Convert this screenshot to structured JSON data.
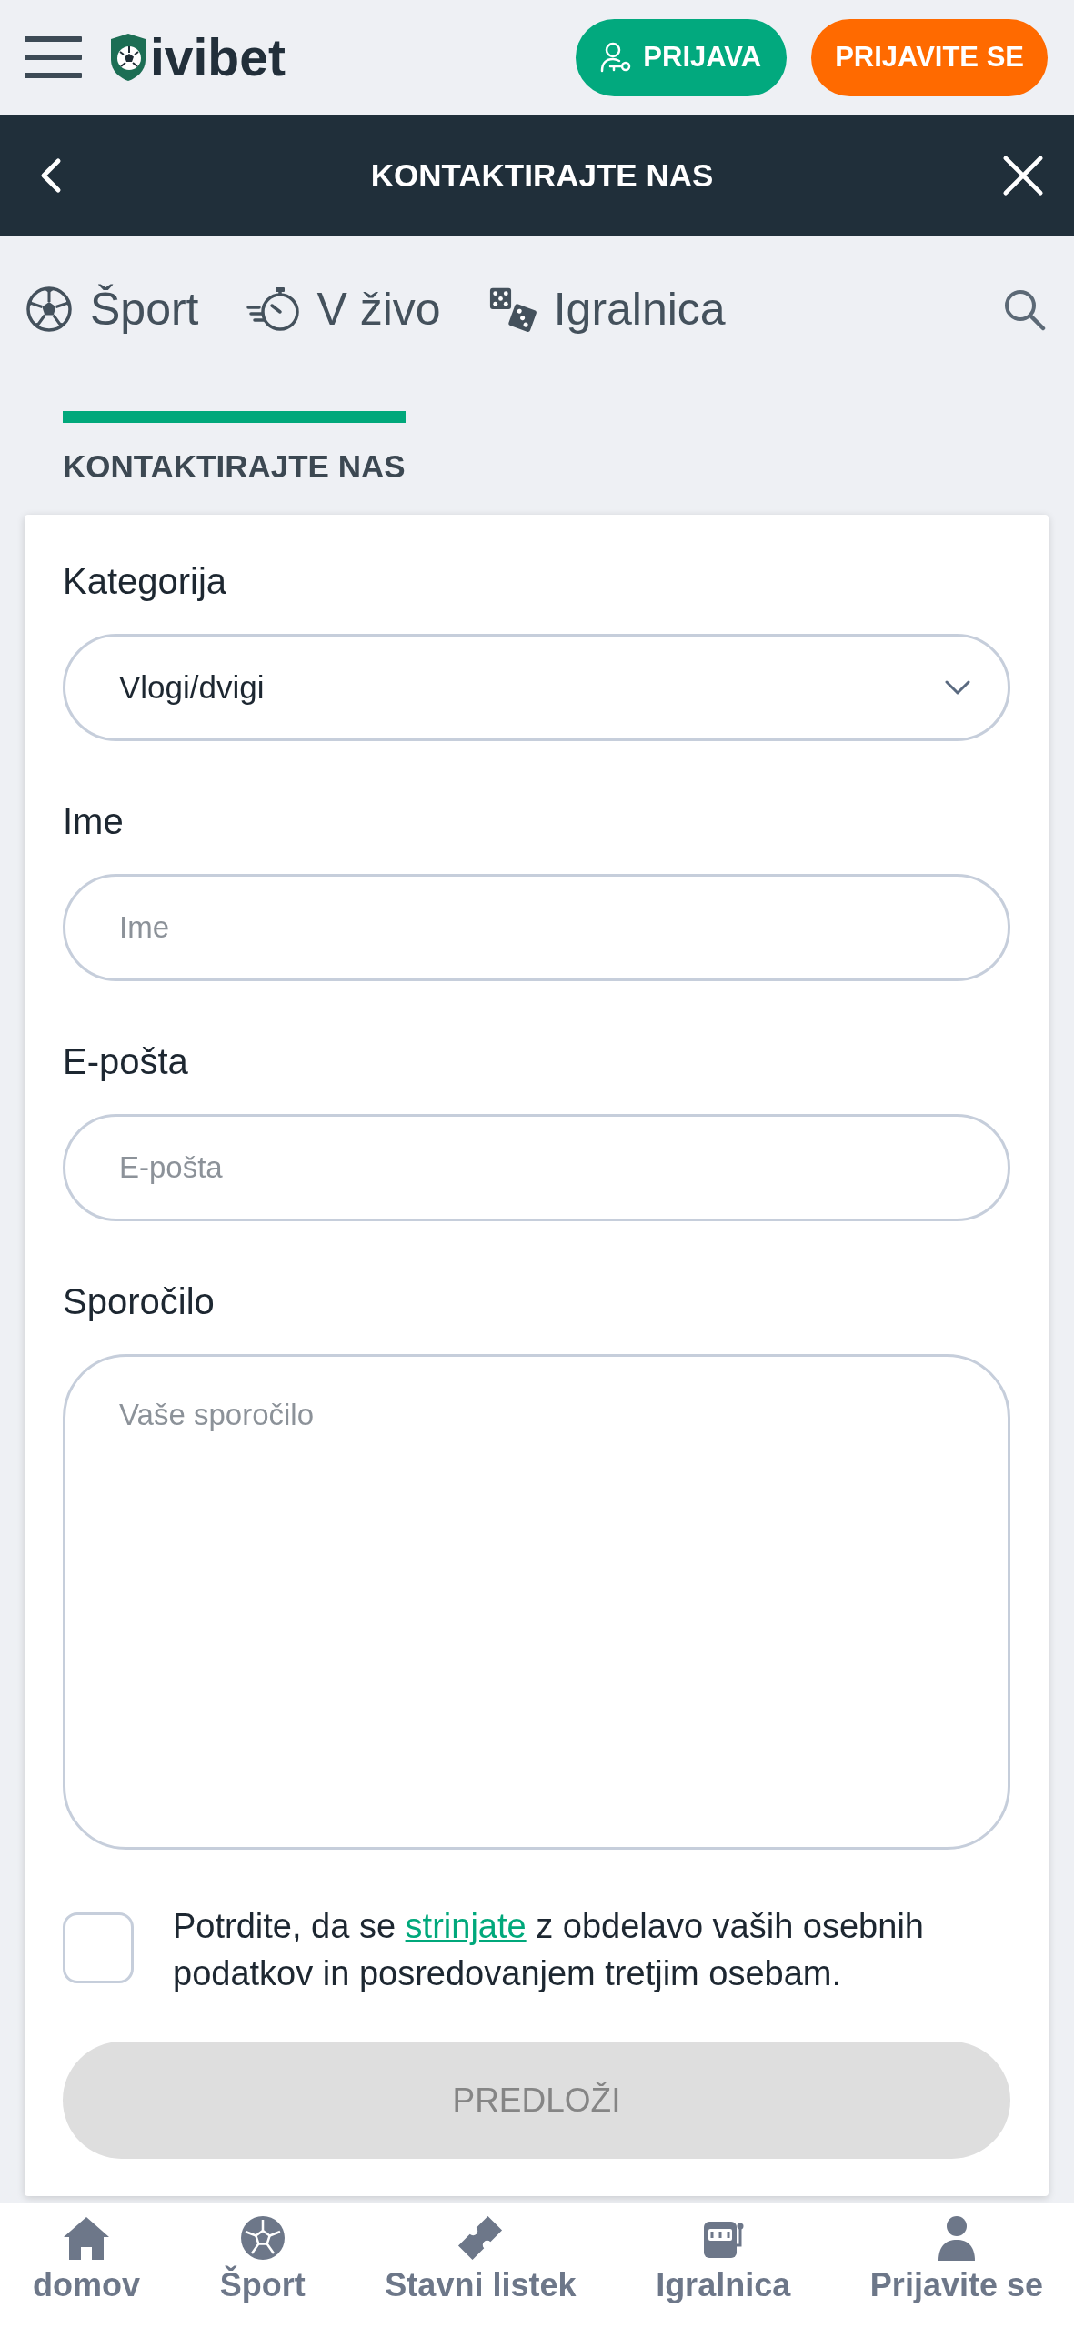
{
  "header": {
    "logo_text": "ivibet",
    "login_button": "PRIJAVA",
    "register_button": "PRIJAVITE SE"
  },
  "title_bar": {
    "title": "KONTAKTIRAJTE NAS"
  },
  "nav": [
    {
      "kind": "ball",
      "label": "Šport",
      "selected": false
    },
    {
      "kind": "live",
      "label": "V živo",
      "selected": false
    },
    {
      "kind": "dice",
      "label": "Igralnica",
      "selected": false
    }
  ],
  "section_tabs": [
    {
      "label": "KONTAKTIRAJTE NAS",
      "selected": true
    }
  ],
  "form": {
    "fields": [
      {
        "kind": "select",
        "label": "Kategorija",
        "value": "Vlogi/dvigi"
      },
      {
        "kind": "input",
        "label": "Ime",
        "placeholder": "Ime"
      },
      {
        "kind": "input",
        "label": "E-pošta",
        "placeholder": "E-pošta"
      },
      {
        "kind": "textarea",
        "label": "Sporočilo",
        "placeholder": "Vaše sporočilo"
      }
    ],
    "consent": {
      "checked": false,
      "text_before": "Potrdite, da se",
      "link": "strinjate",
      "text_after": "z obdelavo vaših osebnih podatkov in posredovanjem tretjim osebam."
    },
    "submit": {
      "label": "PREDLOŽI",
      "disabled": true
    }
  },
  "bottom_nav": [
    {
      "kind": "home",
      "label": "domov",
      "selected": false
    },
    {
      "kind": "ball",
      "label": "Šport",
      "selected": false
    },
    {
      "kind": "ticket",
      "label": "Stavni listek",
      "selected": false
    },
    {
      "kind": "slot",
      "label": "Igralnica",
      "selected": false
    },
    {
      "kind": "user",
      "label": "Prijavite se",
      "selected": false
    }
  ]
}
